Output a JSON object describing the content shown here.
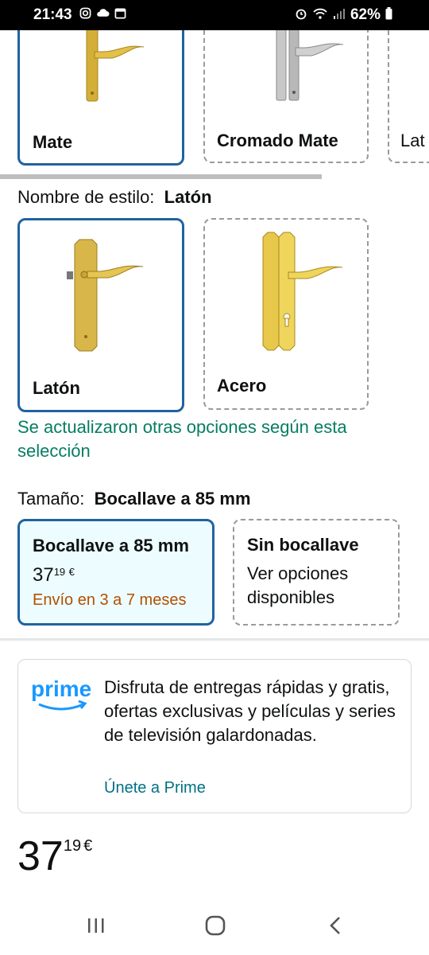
{
  "status_bar": {
    "time": "21:43",
    "battery": "62%",
    "left_icons": [
      "instagram-icon",
      "cloud-icon",
      "calendar-icon"
    ],
    "right_icons": [
      "alarm-icon",
      "wifi-icon",
      "signal-icon",
      "battery-icon"
    ]
  },
  "top_styles": {
    "items": [
      {
        "label": "Mate",
        "selected": true,
        "image": "gold-door-handle"
      },
      {
        "label": "Cromado Mate",
        "selected": false,
        "image": "chrome-door-handle"
      },
      {
        "label": "Lat",
        "selected": false,
        "image": ""
      }
    ]
  },
  "style_section": {
    "label": "Nombre de estilo:",
    "value": "Latón",
    "items": [
      {
        "label": "Latón",
        "selected": true,
        "image": "brass-door-handle"
      },
      {
        "label": "Acero",
        "selected": false,
        "image": "steel-gold-door-handle"
      }
    ],
    "notice": "Se actualizaron otras opciones según esta selección"
  },
  "size_section": {
    "label": "Tamaño:",
    "value": "Bocallave a 85 mm",
    "items": [
      {
        "title": "Bocallave a 85 mm",
        "price_whole": "37",
        "price_fraction": "19",
        "currency": "€",
        "shipping": "Envío en 3 a 7 meses",
        "selected": true
      },
      {
        "title": "Sin bocallave",
        "subtitle": "Ver opciones disponibles",
        "selected": false
      }
    ]
  },
  "prime": {
    "logo_text": "prime",
    "description": "Disfruta de entregas rápidas y gratis, ofertas exclusivas y películas y series de televisión galardonadas.",
    "link": "Únete a Prime"
  },
  "price": {
    "whole": "37",
    "fraction": "19",
    "currency": "€"
  },
  "colors": {
    "selected_border": "#2162a1",
    "notice_green": "#067d62",
    "shipping_orange": "#b34f00",
    "link_teal": "#007185",
    "prime_blue": "#1a98ff"
  },
  "nav_bar": [
    "recent-apps-icon",
    "home-icon",
    "back-icon"
  ]
}
